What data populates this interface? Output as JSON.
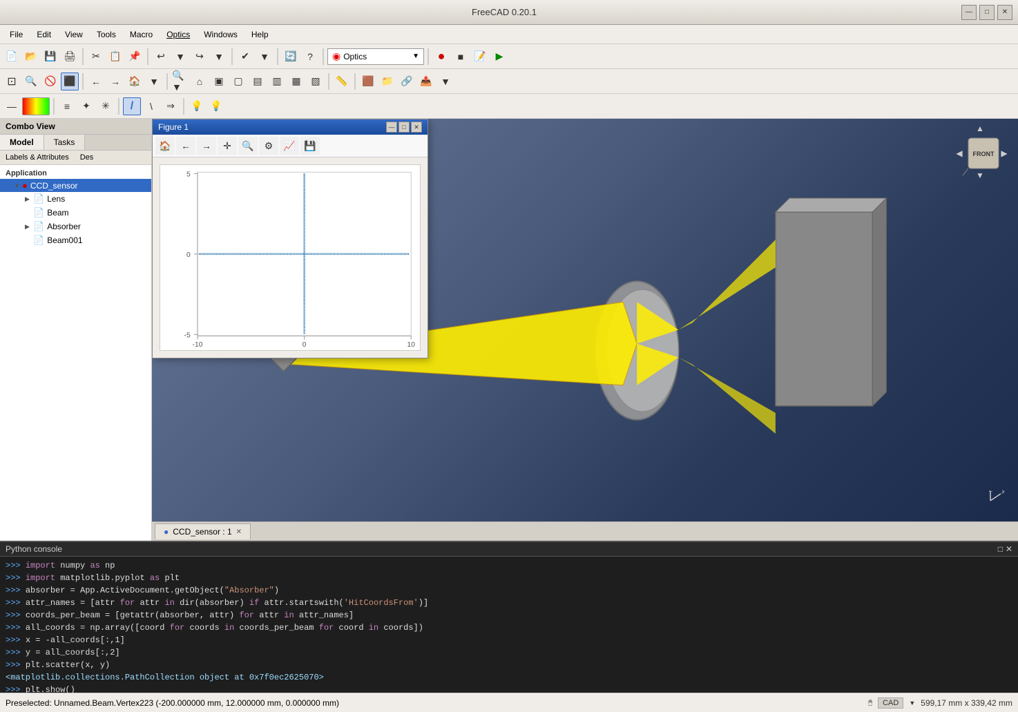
{
  "window": {
    "title": "FreeCAD 0.20.1",
    "controls": {
      "minimize": "—",
      "maximize": "□",
      "close": "✕"
    }
  },
  "menubar": {
    "items": [
      "File",
      "Edit",
      "View",
      "Tools",
      "Macro",
      "Optics",
      "Windows",
      "Help"
    ]
  },
  "toolbar1": {
    "workbench": {
      "icon": "◉",
      "label": "Optics"
    }
  },
  "sidebar": {
    "header": "Combo View",
    "tabs": [
      "Model",
      "Tasks"
    ],
    "active_tab": "Model",
    "labels_row": [
      "Labels & Attributes",
      "Des"
    ],
    "tree": {
      "section": "Application",
      "items": [
        {
          "id": "ccd_sensor",
          "label": "CCD_sensor",
          "indent": 1,
          "expanded": true,
          "icon": "🔴",
          "selected": true
        },
        {
          "id": "lens",
          "label": "Lens",
          "indent": 2,
          "expanded": false,
          "icon": "📄"
        },
        {
          "id": "beam",
          "label": "Beam",
          "indent": 2,
          "icon": "📄"
        },
        {
          "id": "absorber",
          "label": "Absorber",
          "indent": 2,
          "expanded": false,
          "icon": "📄"
        },
        {
          "id": "beam001",
          "label": "Beam001",
          "indent": 2,
          "icon": "📄"
        }
      ]
    }
  },
  "figure1": {
    "title": "Figure 1",
    "toolbar_buttons": [
      "🏠",
      "←",
      "→",
      "✛",
      "🔍",
      "⚙",
      "📈",
      "💾"
    ],
    "plot": {
      "x_labels": [
        "-10",
        "0",
        "10"
      ],
      "y_labels": [
        "-5",
        "0",
        "5"
      ]
    }
  },
  "viewport": {
    "tab": {
      "label": "CCD_sensor : 1",
      "close": "✕"
    }
  },
  "python_console": {
    "header": "Python console",
    "controls": [
      "□",
      "✕"
    ],
    "lines": [
      {
        "type": "input",
        "content": "import numpy as np"
      },
      {
        "type": "input",
        "content": "import matplotlib.pyplot as plt"
      },
      {
        "type": "input",
        "content": "absorber = App.ActiveDocument.getObject(\"Absorber\")"
      },
      {
        "type": "input",
        "content": "attr_names = [attr for attr in dir(absorber) if attr.startswith('HitCoordsFrom')]"
      },
      {
        "type": "input",
        "content": "coords_per_beam = [getattr(absorber, attr) for attr in attr_names]"
      },
      {
        "type": "input",
        "content": "all_coords = np.array([coord for coords in coords_per_beam for coord in coords])"
      },
      {
        "type": "input",
        "content": "x = -all_coords[:,1]"
      },
      {
        "type": "input",
        "content": "y = all_coords[:,2]"
      },
      {
        "type": "input",
        "content": "plt.scatter(x, y)"
      },
      {
        "type": "result",
        "content": "<matplotlib.collections.PathCollection object at 0x7f0ec2625070>"
      },
      {
        "type": "input",
        "content": "plt.show()"
      }
    ]
  },
  "statusbar": {
    "preselected": "Preselected: Unnamed.Beam.Vertex223 (-200.000000 mm, 12.000000 mm, 0.000000 mm)",
    "cad_label": "CAD",
    "dimensions": "599,17 mm x 339,42 mm"
  }
}
